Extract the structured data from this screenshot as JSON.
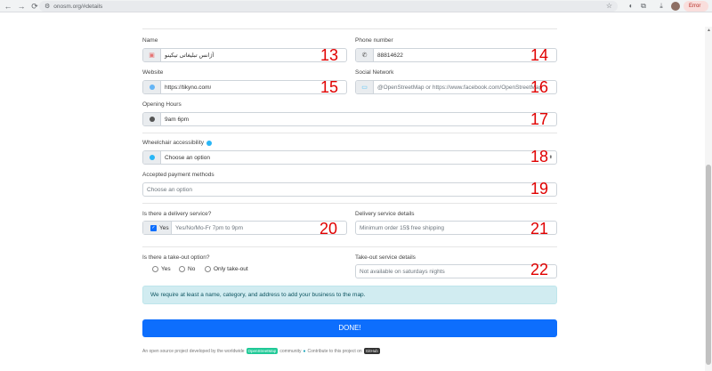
{
  "browser": {
    "url": "onosm.org/#details",
    "error_chip": "Error"
  },
  "form": {
    "name": {
      "label": "Name",
      "value": "آژانس تبلیغاتی تیکینو",
      "marker": "13"
    },
    "phone": {
      "label": "Phone number",
      "value": "88814622",
      "marker": "14"
    },
    "website": {
      "label": "Website",
      "value": "https://tikyno.com/",
      "marker": "15"
    },
    "social": {
      "label": "Social Network",
      "placeholder": "@OpenStreetMap or https://www.facebook.com/OpenStreetMap",
      "marker": "16"
    },
    "hours": {
      "label": "Opening Hours",
      "value": "9am 6pm",
      "marker": "17"
    },
    "wheelchair": {
      "label": "Wheelchair accessibility",
      "placeholder": "Choose an option",
      "marker": "18"
    },
    "payment": {
      "label": "Accepted payment methods",
      "placeholder": "Choose an option",
      "marker": "19"
    },
    "delivery": {
      "label": "Is there a delivery service?",
      "check_label": "Yes",
      "checked": true,
      "placeholder": "Yes/No/Mo-Fr 7pm to 9pm",
      "marker": "20"
    },
    "delivery_details": {
      "label": "Delivery service details",
      "placeholder": "Minimum order 15$ free shipping",
      "marker": "21"
    },
    "takeout": {
      "label": "Is there a take-out option?",
      "options": [
        "Yes",
        "No",
        "Only take-out"
      ]
    },
    "takeout_details": {
      "label": "Take-out service details",
      "placeholder": "Not available on saturdays nights",
      "marker": "22"
    }
  },
  "notice": "We require at least a name, category, and address to add your business to the map.",
  "done_button": "DONE!",
  "footer": {
    "text1": "An open source project developed by the worldwide",
    "osm_badge": "OpenStreetMap",
    "text2": "community",
    "text3": "Contribute to this project on",
    "github_badge": "GitHub"
  }
}
